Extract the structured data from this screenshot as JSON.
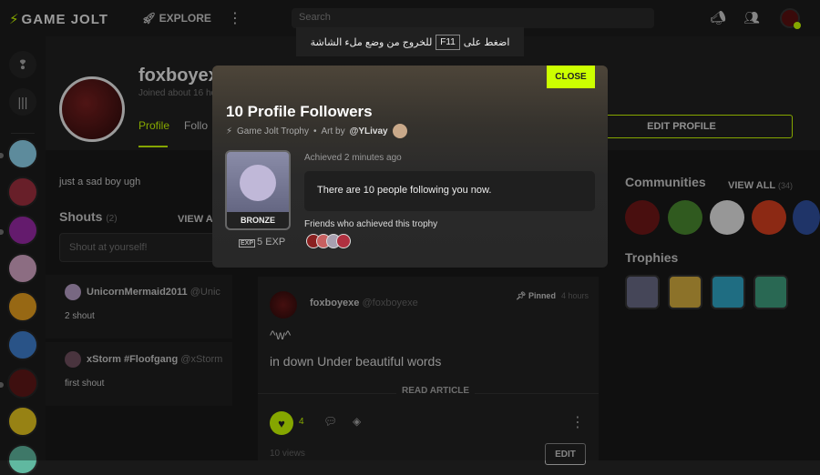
{
  "topbar": {
    "logo": "GAME JOLT",
    "explore": "EXPLORE",
    "search_placeholder": "Search"
  },
  "toast": {
    "before_key": "اضغط على",
    "key": "F11",
    "after_key": "للخروج من وضع ملء الشاشة"
  },
  "profile": {
    "username": "foxboyexe",
    "joined": "Joined about 16 ho",
    "tab_profile": "Profile",
    "tab_following": "Follo",
    "edit_profile": "EDIT PROFILE",
    "bio": "just a sad boy ugh"
  },
  "shouts": {
    "title": "Shouts",
    "count": "(2)",
    "view_all": "VIEW AL",
    "input_placeholder": "Shout at yourself!",
    "items": [
      {
        "author": "UnicornMermaid2011",
        "handle": "@Unic",
        "text": "2 shout"
      },
      {
        "author": "xStorm #Floofgang",
        "handle": "@xStorm",
        "text": "first shout"
      }
    ]
  },
  "post": {
    "author": "foxboyexe",
    "handle": "@foxboyexe",
    "pinned": "Pinned",
    "time": "4 hours",
    "line1": "^w^",
    "line2": "in down Under beautiful words",
    "read_article": "READ ARTICLE",
    "likes": "4",
    "views": "10 views",
    "edit": "EDIT"
  },
  "sidebar_right": {
    "communities_title": "Communities",
    "view_all": "VIEW ALL",
    "view_all_count": "(34)",
    "trophies_title": "Trophies"
  },
  "modal": {
    "close": "CLOSE",
    "title": "10 Profile Followers",
    "source": "Game Jolt Trophy",
    "art_by": "Art by",
    "artist": "@YLivay",
    "rank": "BRONZE",
    "exp": "5 EXP",
    "achieved": "Achieved 2 minutes ago",
    "description": "There are 10 people following you now.",
    "friends_label": "Friends who achieved this trophy"
  },
  "colors": {
    "accent": "#ccff00",
    "background": "#191919"
  }
}
